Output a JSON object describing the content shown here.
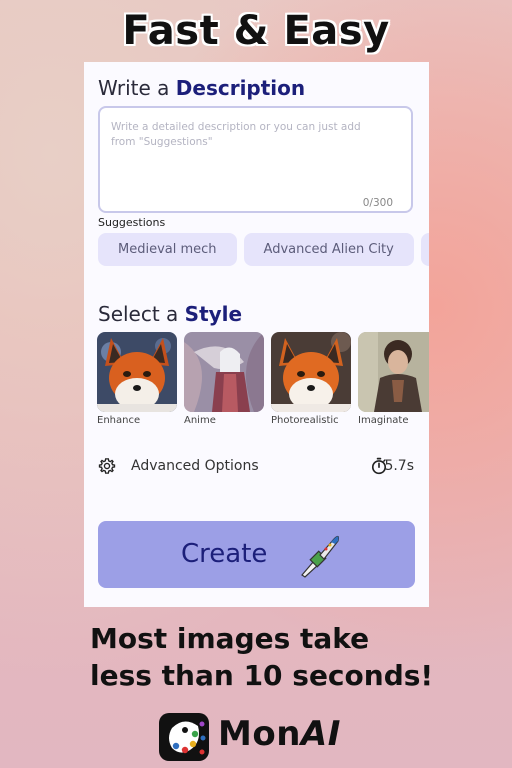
{
  "headline": "Fast & Easy",
  "description": {
    "title_prefix": "Write a ",
    "title_emphasis": "Description",
    "placeholder": "Write a detailed description or you can just add from \"Suggestions\"",
    "counter": "0/300"
  },
  "suggestions": {
    "label": "Suggestions",
    "chips": [
      "Medieval mech",
      "Advanced Alien City"
    ]
  },
  "style": {
    "title_prefix": "Select a ",
    "title_emphasis": "Style",
    "items": [
      {
        "label": "Enhance"
      },
      {
        "label": "Anime"
      },
      {
        "label": "Photorealistic"
      },
      {
        "label": "Imaginate"
      }
    ]
  },
  "advanced": {
    "label": "Advanced Options",
    "icon": "gear-icon",
    "time": "5.7s",
    "time_icon": "timer-icon"
  },
  "create_button": {
    "label": "Create",
    "icon": "paintbrush-icon"
  },
  "tagline": {
    "line1": "Most images take",
    "line2": "less than 10 seconds!"
  },
  "logo": {
    "text_plain": "Mon",
    "text_italic": "AI"
  },
  "colors": {
    "accent_dark": "#1c1f7a",
    "chip_bg": "#e6e4fb",
    "button_bg": "#9c9fe6"
  }
}
